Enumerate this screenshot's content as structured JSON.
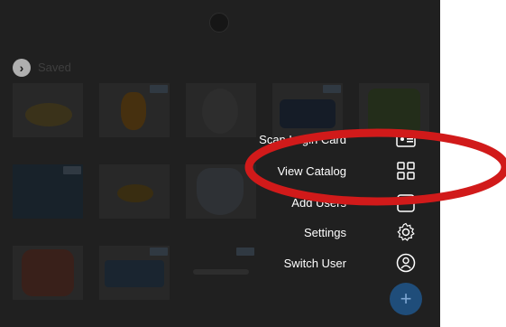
{
  "header": {
    "section_label": "Saved"
  },
  "catalog": {
    "row1_labels": [
      "",
      "",
      "",
      "",
      ""
    ],
    "row2_labels": [
      "",
      "",
      "",
      "",
      ""
    ],
    "row3_labels": [
      "",
      "",
      "",
      ""
    ]
  },
  "menu": {
    "items": [
      {
        "label": "Scan Login Card",
        "icon": "id-card-icon"
      },
      {
        "label": "View Catalog",
        "icon": "grid-icon"
      },
      {
        "label": "Add Users",
        "icon": "user-box-icon"
      },
      {
        "label": "Settings",
        "icon": "gear-icon"
      },
      {
        "label": "Switch User",
        "icon": "person-icon"
      }
    ]
  },
  "annotation": {
    "color": "#d11a1a",
    "target": "View Catalog"
  }
}
